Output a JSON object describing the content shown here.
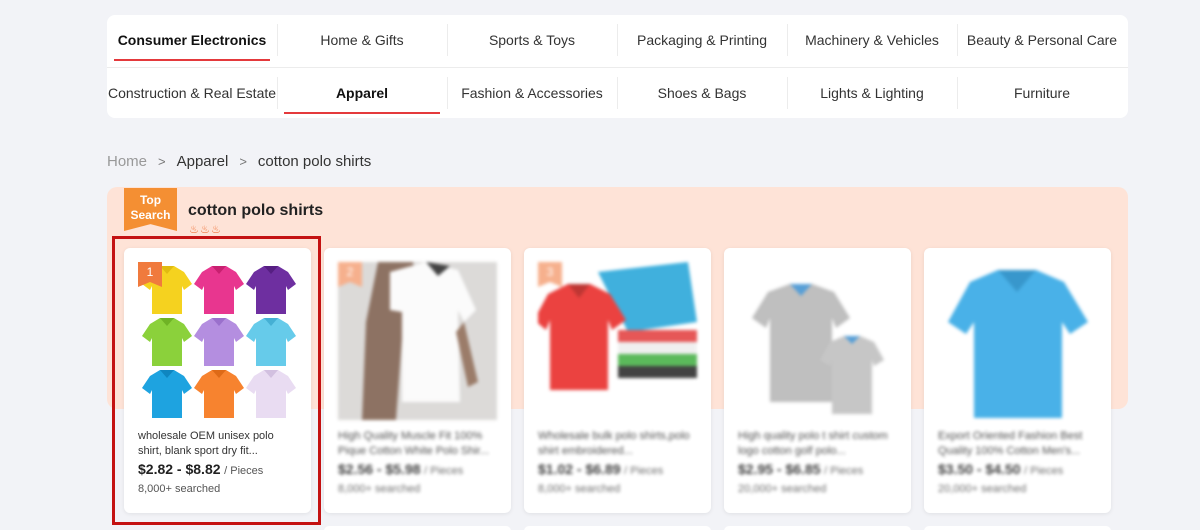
{
  "categories": {
    "row1": [
      "Consumer Electronics",
      "Home & Gifts",
      "Sports & Toys",
      "Packaging & Printing",
      "Machinery & Vehicles",
      "Beauty & Personal Care"
    ],
    "row2": [
      "Construction & Real Estate",
      "Apparel",
      "Fashion & Accessories",
      "Shoes & Bags",
      "Lights & Lighting",
      "Furniture"
    ]
  },
  "breadcrumb": {
    "home": "Home",
    "sep": ">",
    "level1": "Apparel",
    "level2": "cotton polo shirts"
  },
  "top_search": {
    "badge_line1": "Top",
    "badge_line2": "Search",
    "title": "cotton polo shirts"
  },
  "products": [
    {
      "rank": "1",
      "name": "wholesale OEM unisex polo shirt, blank sport dry fit...",
      "price": "$2.82 - $8.82",
      "unit": "/ Pieces",
      "searched": "8,000+ searched"
    },
    {
      "rank": "2",
      "name": "High Quality Muscle Fit 100% Pique Cotton White Polo Shir...",
      "price": "$2.56 - $5.98",
      "unit": "/ Pieces",
      "searched": "8,000+ searched"
    },
    {
      "rank": "3",
      "name": "Wholesale bulk polo shirts,polo shirt embroidered...",
      "price": "$1.02 - $6.89",
      "unit": "/ Pieces",
      "searched": "8,000+ searched"
    },
    {
      "rank": "",
      "name": "High quality polo t shirt custom logo cotton golf polo...",
      "price": "$2.95 - $6.85",
      "unit": "/ Pieces",
      "searched": "20,000+ searched"
    },
    {
      "rank": "",
      "name": "Export Oriented Fashion Best Quality 100% Cotton Men's...",
      "price": "$3.50 - $4.50",
      "unit": "/ Pieces",
      "searched": "20,000+ searched"
    }
  ],
  "colors": {
    "accent": "#e4393c",
    "badge": "#f48f33",
    "panel": "#fee3d7",
    "highlight": "#c41212"
  }
}
